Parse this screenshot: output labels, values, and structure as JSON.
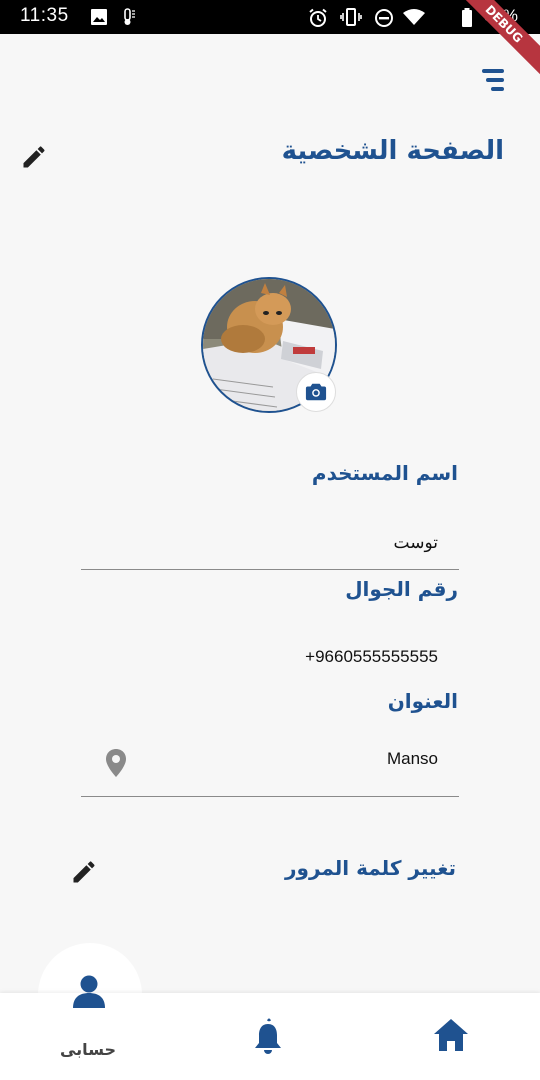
{
  "status_bar": {
    "time": "11:35",
    "battery": "83%",
    "icons": [
      "image-icon",
      "thermometer-icon",
      "alarm-icon",
      "vibrate-icon",
      "dnd-icon",
      "wifi-icon",
      "battery-icon"
    ],
    "debug_banner": "DEBUG"
  },
  "header": {
    "title": "الصفحة الشخصية",
    "menu_icon": "menu-icon",
    "edit_icon": "edit-icon"
  },
  "profile": {
    "avatar_icon": "avatar-photo",
    "camera_icon": "camera-icon"
  },
  "fields": {
    "username_label": "اسم المستخدم",
    "username_value": "توست",
    "phone_label": "رقم الجوال",
    "phone_value": "+9660555555555",
    "address_label": "العنوان",
    "address_value": "Manso",
    "address_icon": "location-pin-icon"
  },
  "change_password": {
    "label": "تغيير كلمة المرور",
    "icon": "edit-icon"
  },
  "bottom_nav": {
    "account_label": "حسابى",
    "items": [
      "account-icon",
      "bell-icon",
      "home-icon"
    ]
  },
  "colors": {
    "primary": "#1f5290",
    "background": "#f7f7f7",
    "icon_dark": "#222222",
    "icon_gray": "#8a8a8a"
  }
}
